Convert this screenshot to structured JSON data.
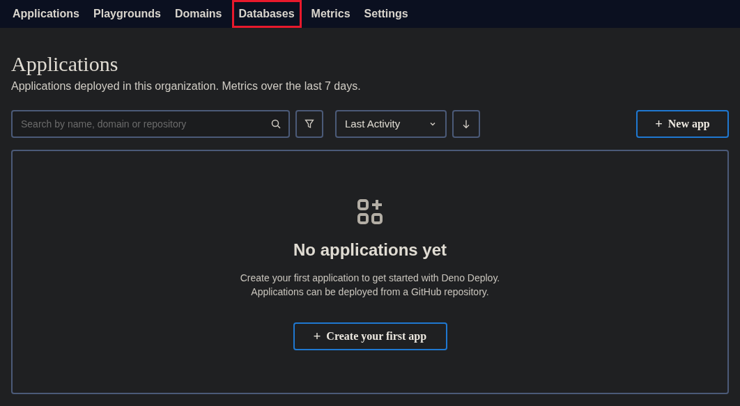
{
  "nav": {
    "tabs": [
      {
        "label": "Applications",
        "highlighted": false
      },
      {
        "label": "Playgrounds",
        "highlighted": false
      },
      {
        "label": "Domains",
        "highlighted": false
      },
      {
        "label": "Databases",
        "highlighted": true
      },
      {
        "label": "Metrics",
        "highlighted": false
      },
      {
        "label": "Settings",
        "highlighted": false
      }
    ]
  },
  "page": {
    "title": "Applications",
    "subtitle": "Applications deployed in this organization. Metrics over the last 7 days."
  },
  "toolbar": {
    "search": {
      "placeholder": "Search by name, domain or repository"
    },
    "sort": {
      "value": "Last Activity"
    },
    "new_button": {
      "icon": "+",
      "label": "New app"
    }
  },
  "empty_state": {
    "heading": "No applications yet",
    "lines": [
      "Create your first application to get started with Deno Deploy.",
      "Applications can be deployed from a GitHub repository."
    ],
    "button": {
      "icon": "+",
      "label": "Create your first app"
    }
  }
}
